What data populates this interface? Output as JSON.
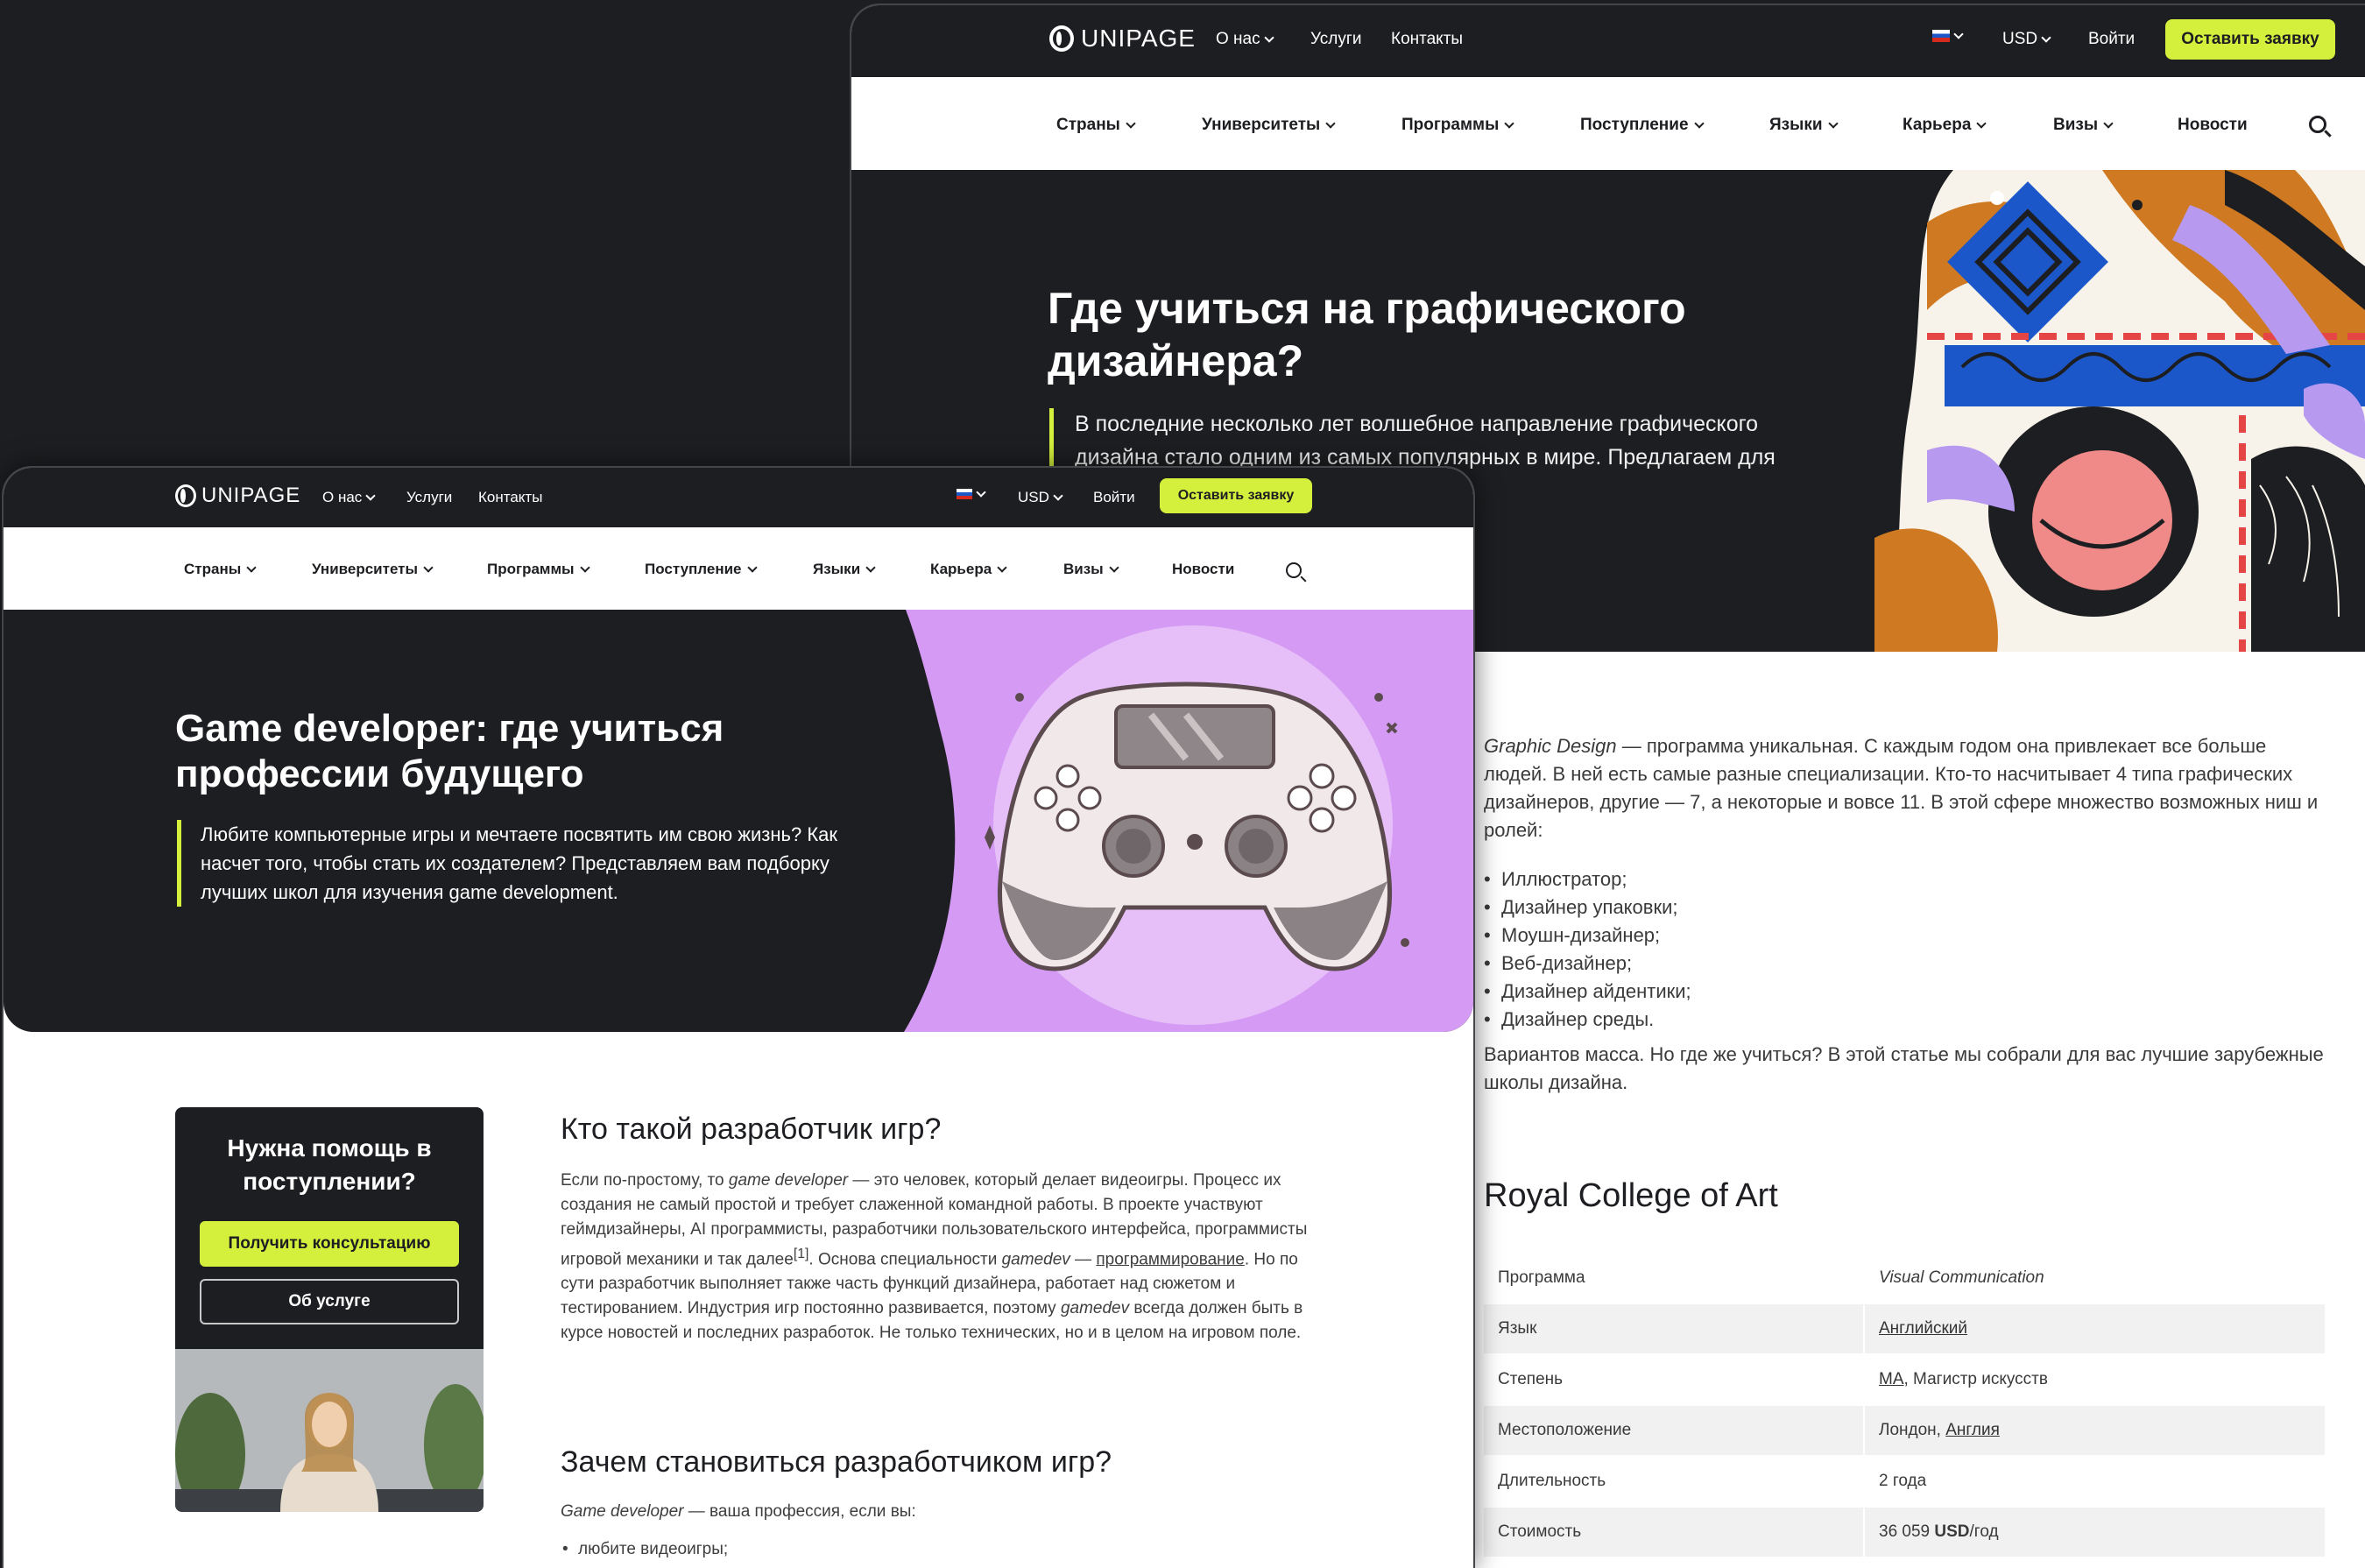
{
  "back_page": {
    "brand": "UNIPAGE",
    "topbar": {
      "links": [
        "О нас",
        "Услуги",
        "Контакты"
      ],
      "currency": "USD",
      "login": "Войти",
      "cta": "Оставить заявку"
    },
    "nav": [
      "Страны",
      "Университеты",
      "Программы",
      "Поступление",
      "Языки",
      "Карьера",
      "Визы",
      "Новости"
    ],
    "hero": {
      "title": "Где учиться на графического дизайнера?",
      "lead": "В последние несколько лет волшебное направление графического дизайна стало одним из самых популярных в мире. Предлагаем для его изучения."
    },
    "intro_italic": "Graphic Design",
    "intro": " — программа уникальная. С каждым годом она привлекает все больше людей. В ней есть самые разные специализации. Кто-то насчитывает 4 типа графических дизайнеров, другие — 7, а некоторые и вовсе 11. В этой сфере множество возможных ниш и ролей:",
    "roles": [
      "Иллюстратор;",
      "Дизайнер упаковки;",
      "Моушн-дизайнер;",
      "Веб-дизайнер;",
      "Дизайнер айдентики;",
      "Дизайнер среды."
    ],
    "outro": "Вариантов масса. Но где же учиться? В этой статье мы собрали для вас лучшие зарубежные школы дизайна.",
    "school": {
      "name": "Royal College of Art",
      "rows": [
        {
          "label": "Программа",
          "value": "Visual Communication"
        },
        {
          "label": "Язык",
          "value": "Английский"
        },
        {
          "label": "Степень",
          "value_link": "MA",
          "value_rest": ", Магистр искусств"
        },
        {
          "label": "Местоположение",
          "value_plain": "Лондон, ",
          "value_link": "Англия"
        },
        {
          "label": "Длительность",
          "value": "2 года"
        },
        {
          "label": "Стоимость",
          "value_num": "36 059 ",
          "value_bold": "USD",
          "value_rest": "/год"
        }
      ]
    }
  },
  "front_page": {
    "brand": "UNIPAGE",
    "topbar": {
      "links": [
        "О нас",
        "Услуги",
        "Контакты"
      ],
      "currency": "USD",
      "login": "Войти",
      "cta": "Оставить заявку"
    },
    "nav": [
      "Страны",
      "Университеты",
      "Программы",
      "Поступление",
      "Языки",
      "Карьера",
      "Визы",
      "Новости"
    ],
    "hero": {
      "title": "Game developer: где учиться профессии будущего",
      "lead": "Любите компьютерные игры и мечтаете посвятить им свою жизнь? Как насчет того, чтобы стать их создателем? Представляем вам подборку лучших школ для изучения game development."
    },
    "help_card": {
      "title": "Нужна помощь в поступлении?",
      "primary": "Получить консультацию",
      "secondary": "Об услуге"
    },
    "section1": {
      "heading": "Кто такой разработчик игр?",
      "p1_a": "Если по-простому, то ",
      "p1_i": "game developer",
      "p1_b": " — это человек, который делает видеоигры. Процесс их создания не самый простой и требует слаженной командной работы. В проекте участвуют геймдизайнеры, AI программисты, разработчики пользовательского интерфейса, программисты игровой механики и так далее",
      "p1_sup": "[1]",
      "p1_c": ". Основа специальности ",
      "p1_i2": "gamedev",
      "p1_d": " — ",
      "p1_link": "программирование",
      "p1_e": ". Но по сути разработчик выполняет также часть функций дизайнера, работает над сюжетом и тестированием. Индустрия игр постоянно развивается, поэтому ",
      "p1_i3": "gamedev",
      "p1_f": " всегда должен быть в курсе новостей и последних разработок. Не только технических, но и в целом на игровом поле."
    },
    "section2": {
      "heading": "Зачем становиться разработчиком игр?",
      "p_i": "Game developer",
      "p_rest": " — ваша профессия, если вы:",
      "items": [
        "любите видеоигры;"
      ]
    }
  },
  "colors": {
    "dark": "#1d1e21",
    "accent": "#d4ef3c",
    "hero_lilac": "#d59bf4"
  }
}
